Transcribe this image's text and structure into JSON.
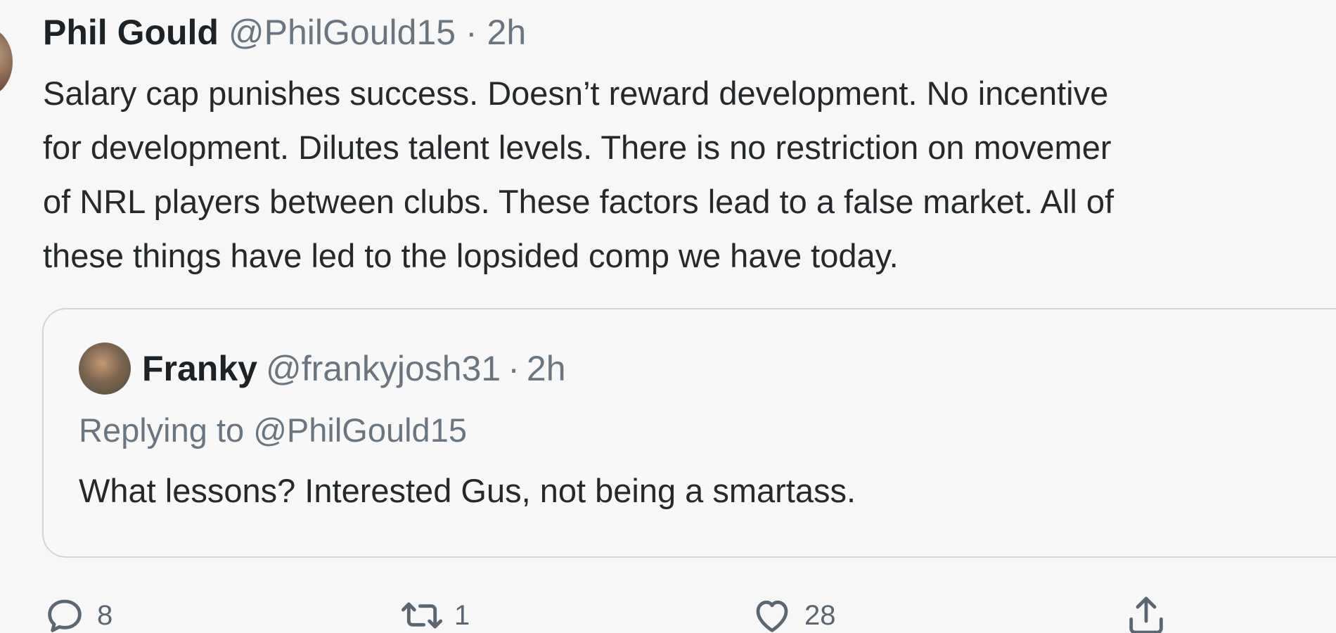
{
  "tweet": {
    "author_name": "Phil Gould",
    "handle": "@PhilGould15",
    "separator": "·",
    "time": "2h",
    "text_lines": [
      "Salary cap punishes success. Doesn’t  reward development. No incentive",
      "for development. Dilutes talent levels. There is no restriction on movemer",
      "of NRL players between clubs. These factors lead to a false market. All of",
      "these things have led to the lopsided comp we have today."
    ]
  },
  "quoted_tweet": {
    "author_name": "Franky",
    "handle": "@frankyjosh31",
    "separator": "·",
    "time": "2h",
    "replying_to": "Replying to @PhilGould15",
    "text": "What lessons? Interested Gus, not being a smartass."
  },
  "actions": {
    "reply_count": "8",
    "retweet_count": "1",
    "like_count": "28"
  },
  "icons": {
    "reply": "reply-icon",
    "retweet": "retweet-icon",
    "like": "heart-icon",
    "share": "share-icon"
  },
  "colors": {
    "text": "#0f1419",
    "muted": "#6b7580",
    "border": "#cfd5da",
    "background": "#f7f7f7"
  }
}
